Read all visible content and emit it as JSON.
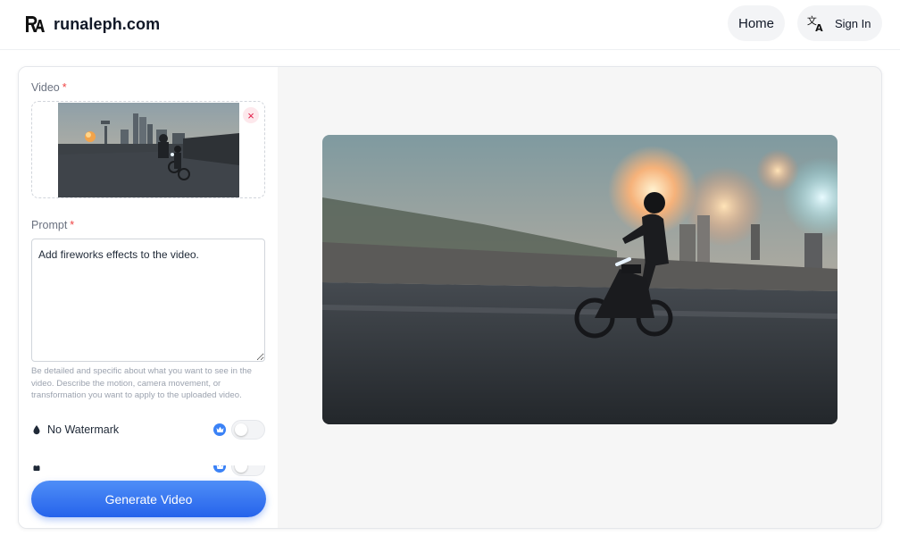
{
  "header": {
    "brand_name": "runaleph.com",
    "brand_icon": "ra-logo-icon",
    "nav_home": "Home",
    "nav_signin": "Sign In",
    "language_icon": "translate-icon"
  },
  "form": {
    "video_label": "Video",
    "required_mark": "*",
    "remove_icon": "×",
    "prompt_label": "Prompt",
    "prompt_value": "Add fireworks effects to the video.",
    "hint": "Be detailed and specific about what you want to see in the video. Describe the motion, camera movement, or transformation you want to apply to the uploaded video.",
    "options": [
      {
        "label": "No Watermark",
        "icon": "droplet-icon",
        "premium_icon": "crown-icon",
        "enabled": false
      },
      {
        "label": "",
        "icon": "lock-icon",
        "premium_icon": "crown-icon",
        "enabled": false
      }
    ],
    "generate_label": "Generate Video"
  },
  "colors": {
    "accent": "#2f74f0",
    "required": "#ef4444",
    "remove": "#e11d48"
  }
}
